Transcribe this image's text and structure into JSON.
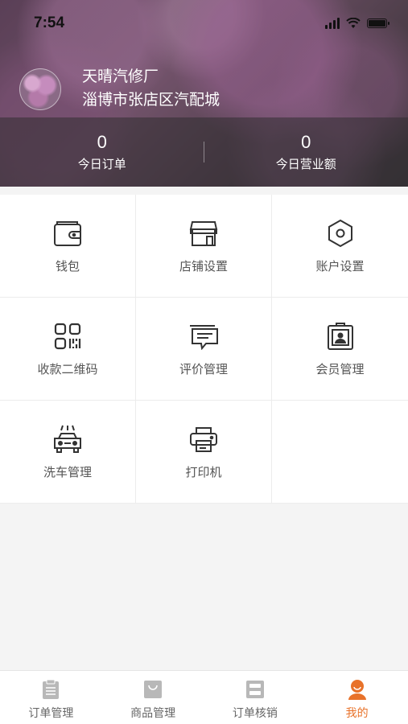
{
  "status_bar": {
    "time": "7:54"
  },
  "profile": {
    "shop_name": "天晴汽修厂",
    "shop_address": "淄博市张店区汽配城"
  },
  "stats": [
    {
      "value": "0",
      "label": "今日订单"
    },
    {
      "value": "0",
      "label": "今日营业额"
    }
  ],
  "menu": [
    {
      "label": "钱包",
      "icon": "wallet-icon"
    },
    {
      "label": "店铺设置",
      "icon": "store-icon"
    },
    {
      "label": "账户设置",
      "icon": "hexagon-settings-icon"
    },
    {
      "label": "收款二维码",
      "icon": "qr-code-icon"
    },
    {
      "label": "评价管理",
      "icon": "review-message-icon"
    },
    {
      "label": "会员管理",
      "icon": "member-badge-icon"
    },
    {
      "label": "洗车管理",
      "icon": "car-wash-icon"
    },
    {
      "label": "打印机",
      "icon": "printer-icon"
    }
  ],
  "tabs": [
    {
      "label": "订单管理",
      "icon": "clipboard-icon",
      "active": false
    },
    {
      "label": "商品管理",
      "icon": "shopping-bag-icon",
      "active": false
    },
    {
      "label": "订单核销",
      "icon": "scan-verify-icon",
      "active": false
    },
    {
      "label": "我的",
      "icon": "user-icon",
      "active": true
    }
  ],
  "colors": {
    "accent": "#e8722a",
    "icon_gray": "#b8b8b8",
    "text_gray": "#555555"
  }
}
